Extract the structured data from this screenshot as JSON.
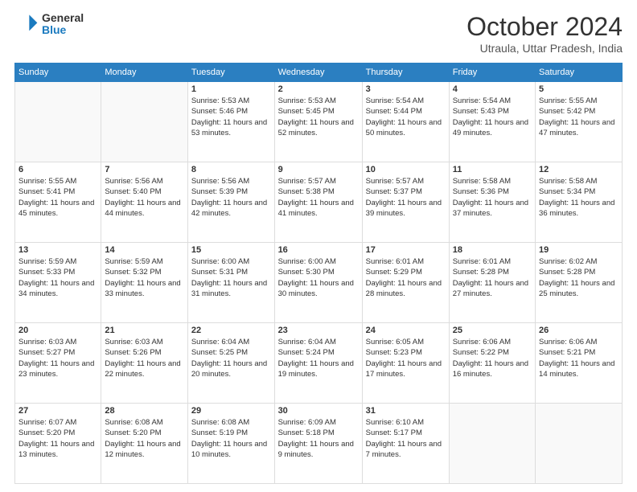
{
  "logo": {
    "general": "General",
    "blue": "Blue"
  },
  "header": {
    "month": "October 2024",
    "location": "Utraula, Uttar Pradesh, India"
  },
  "weekdays": [
    "Sunday",
    "Monday",
    "Tuesday",
    "Wednesday",
    "Thursday",
    "Friday",
    "Saturday"
  ],
  "weeks": [
    [
      {
        "day": "",
        "info": ""
      },
      {
        "day": "",
        "info": ""
      },
      {
        "day": "1",
        "info": "Sunrise: 5:53 AM\nSunset: 5:46 PM\nDaylight: 11 hours and 53 minutes."
      },
      {
        "day": "2",
        "info": "Sunrise: 5:53 AM\nSunset: 5:45 PM\nDaylight: 11 hours and 52 minutes."
      },
      {
        "day": "3",
        "info": "Sunrise: 5:54 AM\nSunset: 5:44 PM\nDaylight: 11 hours and 50 minutes."
      },
      {
        "day": "4",
        "info": "Sunrise: 5:54 AM\nSunset: 5:43 PM\nDaylight: 11 hours and 49 minutes."
      },
      {
        "day": "5",
        "info": "Sunrise: 5:55 AM\nSunset: 5:42 PM\nDaylight: 11 hours and 47 minutes."
      }
    ],
    [
      {
        "day": "6",
        "info": "Sunrise: 5:55 AM\nSunset: 5:41 PM\nDaylight: 11 hours and 45 minutes."
      },
      {
        "day": "7",
        "info": "Sunrise: 5:56 AM\nSunset: 5:40 PM\nDaylight: 11 hours and 44 minutes."
      },
      {
        "day": "8",
        "info": "Sunrise: 5:56 AM\nSunset: 5:39 PM\nDaylight: 11 hours and 42 minutes."
      },
      {
        "day": "9",
        "info": "Sunrise: 5:57 AM\nSunset: 5:38 PM\nDaylight: 11 hours and 41 minutes."
      },
      {
        "day": "10",
        "info": "Sunrise: 5:57 AM\nSunset: 5:37 PM\nDaylight: 11 hours and 39 minutes."
      },
      {
        "day": "11",
        "info": "Sunrise: 5:58 AM\nSunset: 5:36 PM\nDaylight: 11 hours and 37 minutes."
      },
      {
        "day": "12",
        "info": "Sunrise: 5:58 AM\nSunset: 5:34 PM\nDaylight: 11 hours and 36 minutes."
      }
    ],
    [
      {
        "day": "13",
        "info": "Sunrise: 5:59 AM\nSunset: 5:33 PM\nDaylight: 11 hours and 34 minutes."
      },
      {
        "day": "14",
        "info": "Sunrise: 5:59 AM\nSunset: 5:32 PM\nDaylight: 11 hours and 33 minutes."
      },
      {
        "day": "15",
        "info": "Sunrise: 6:00 AM\nSunset: 5:31 PM\nDaylight: 11 hours and 31 minutes."
      },
      {
        "day": "16",
        "info": "Sunrise: 6:00 AM\nSunset: 5:30 PM\nDaylight: 11 hours and 30 minutes."
      },
      {
        "day": "17",
        "info": "Sunrise: 6:01 AM\nSunset: 5:29 PM\nDaylight: 11 hours and 28 minutes."
      },
      {
        "day": "18",
        "info": "Sunrise: 6:01 AM\nSunset: 5:28 PM\nDaylight: 11 hours and 27 minutes."
      },
      {
        "day": "19",
        "info": "Sunrise: 6:02 AM\nSunset: 5:28 PM\nDaylight: 11 hours and 25 minutes."
      }
    ],
    [
      {
        "day": "20",
        "info": "Sunrise: 6:03 AM\nSunset: 5:27 PM\nDaylight: 11 hours and 23 minutes."
      },
      {
        "day": "21",
        "info": "Sunrise: 6:03 AM\nSunset: 5:26 PM\nDaylight: 11 hours and 22 minutes."
      },
      {
        "day": "22",
        "info": "Sunrise: 6:04 AM\nSunset: 5:25 PM\nDaylight: 11 hours and 20 minutes."
      },
      {
        "day": "23",
        "info": "Sunrise: 6:04 AM\nSunset: 5:24 PM\nDaylight: 11 hours and 19 minutes."
      },
      {
        "day": "24",
        "info": "Sunrise: 6:05 AM\nSunset: 5:23 PM\nDaylight: 11 hours and 17 minutes."
      },
      {
        "day": "25",
        "info": "Sunrise: 6:06 AM\nSunset: 5:22 PM\nDaylight: 11 hours and 16 minutes."
      },
      {
        "day": "26",
        "info": "Sunrise: 6:06 AM\nSunset: 5:21 PM\nDaylight: 11 hours and 14 minutes."
      }
    ],
    [
      {
        "day": "27",
        "info": "Sunrise: 6:07 AM\nSunset: 5:20 PM\nDaylight: 11 hours and 13 minutes."
      },
      {
        "day": "28",
        "info": "Sunrise: 6:08 AM\nSunset: 5:20 PM\nDaylight: 11 hours and 12 minutes."
      },
      {
        "day": "29",
        "info": "Sunrise: 6:08 AM\nSunset: 5:19 PM\nDaylight: 11 hours and 10 minutes."
      },
      {
        "day": "30",
        "info": "Sunrise: 6:09 AM\nSunset: 5:18 PM\nDaylight: 11 hours and 9 minutes."
      },
      {
        "day": "31",
        "info": "Sunrise: 6:10 AM\nSunset: 5:17 PM\nDaylight: 11 hours and 7 minutes."
      },
      {
        "day": "",
        "info": ""
      },
      {
        "day": "",
        "info": ""
      }
    ]
  ]
}
